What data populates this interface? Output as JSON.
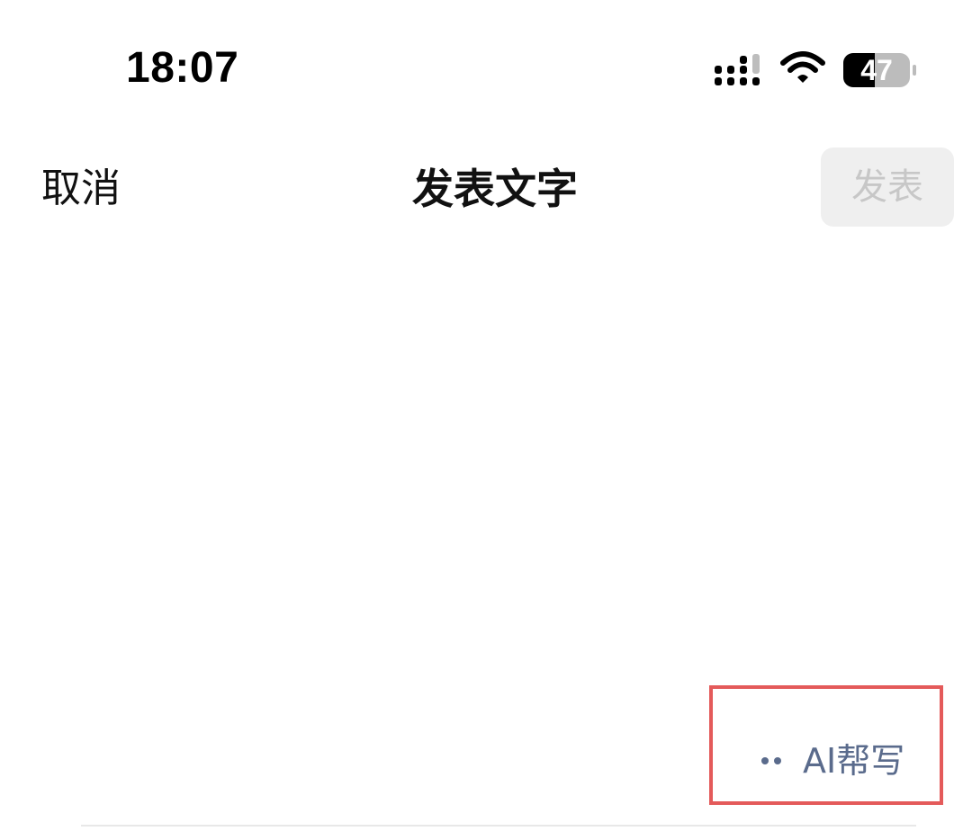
{
  "status_bar": {
    "time": "18:07",
    "battery_level": "47",
    "icons": [
      "signal-icon",
      "wifi-icon",
      "battery-icon"
    ]
  },
  "nav": {
    "cancel_label": "取消",
    "title": "发表文字",
    "publish_label": "发表"
  },
  "ai_helper": {
    "label": "AI帮写",
    "icon": "dots-icon"
  },
  "colors": {
    "highlight_border": "#e45a5a",
    "ai_text": "#5a6b8c",
    "publish_disabled_bg": "#efefef",
    "publish_disabled_text": "#c7c7c7"
  }
}
